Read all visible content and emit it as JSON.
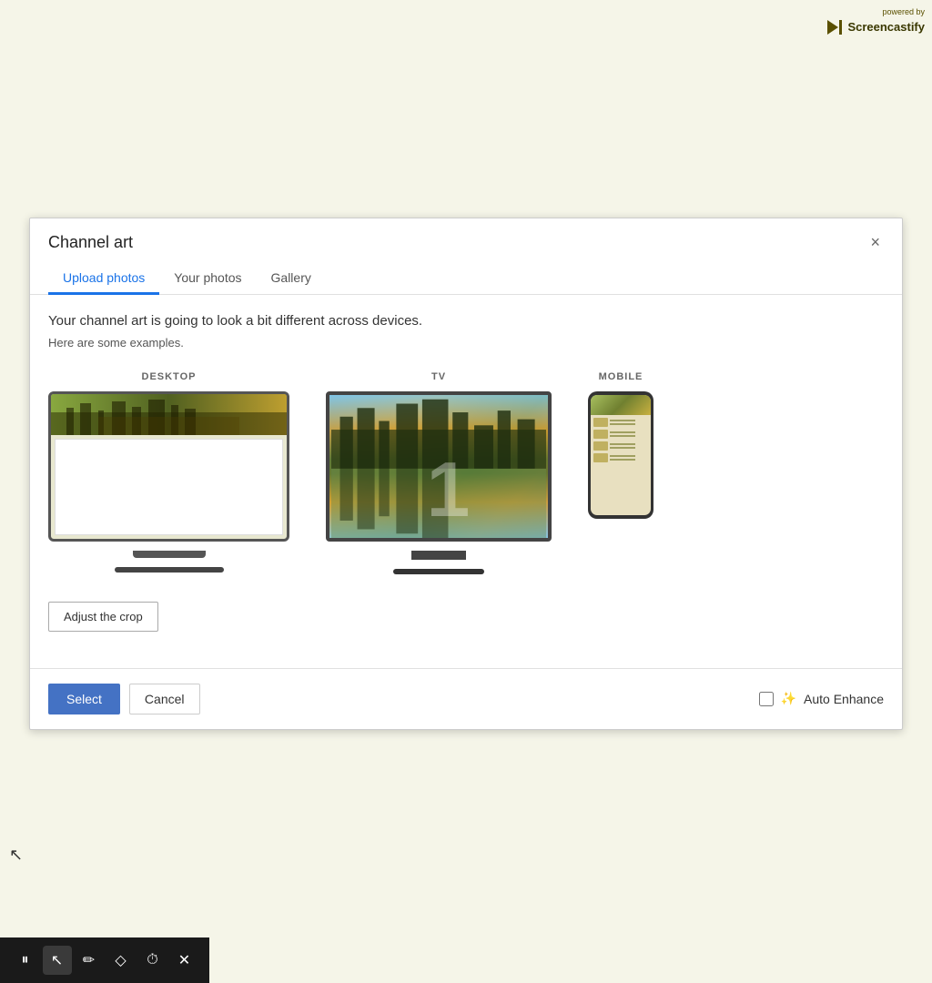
{
  "logo": {
    "powered_by": "powered by",
    "name": "Screencastify"
  },
  "modal": {
    "title": "Channel art",
    "close_label": "×",
    "tabs": [
      {
        "id": "upload",
        "label": "Upload photos",
        "active": true
      },
      {
        "id": "your-photos",
        "label": "Your photos",
        "active": false
      },
      {
        "id": "gallery",
        "label": "Gallery",
        "active": false
      }
    ],
    "description": "Your channel art is going to look a bit different across devices.",
    "sub_description": "Here are some examples.",
    "devices": [
      {
        "id": "desktop",
        "label": "DESKTOP"
      },
      {
        "id": "tv",
        "label": "TV"
      },
      {
        "id": "mobile",
        "label": "MOBILE"
      }
    ],
    "adjust_crop_label": "Adjust the crop",
    "footer": {
      "select_label": "Select",
      "cancel_label": "Cancel",
      "auto_enhance_label": "Auto Enhance"
    }
  },
  "toolbar": {
    "buttons": [
      {
        "id": "pause",
        "icon": "⏸",
        "label": "pause-button"
      },
      {
        "id": "cursor",
        "icon": "↖",
        "label": "cursor-button"
      },
      {
        "id": "pen",
        "icon": "✏",
        "label": "pen-button"
      },
      {
        "id": "shape",
        "icon": "◇",
        "label": "shape-button"
      },
      {
        "id": "timer",
        "icon": "⏱",
        "label": "timer-button"
      },
      {
        "id": "close",
        "icon": "✕",
        "label": "close-button"
      }
    ]
  }
}
